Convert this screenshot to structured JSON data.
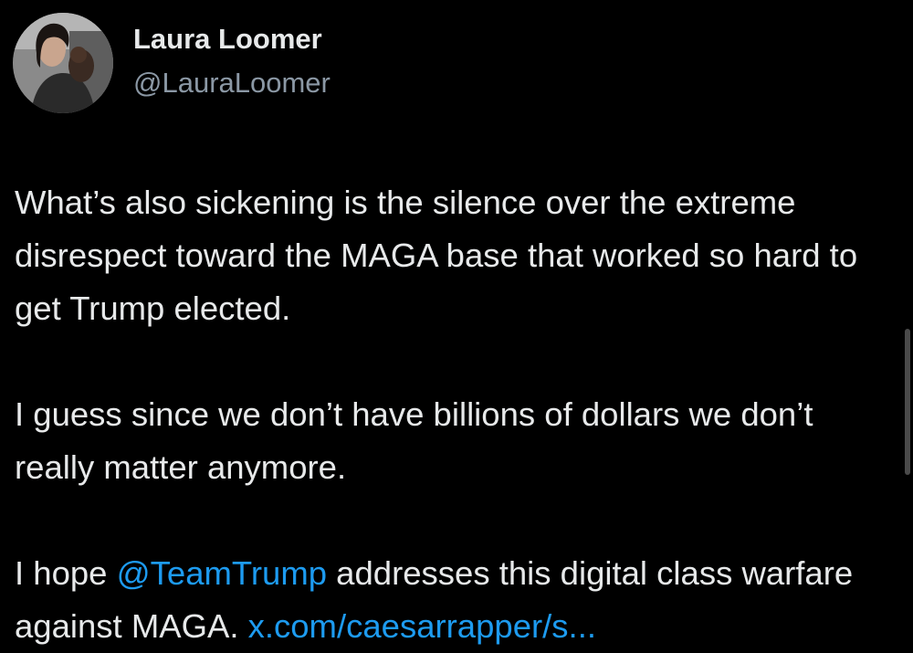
{
  "author": {
    "name": "Laura Loomer",
    "handle": "@LauraLoomer",
    "avatar_icon": "profile-photo"
  },
  "tweet": {
    "paragraph_1": "What’s also sickening is the silence over the extreme disrespect toward the MAGA base that worked so hard to get Trump elected.",
    "paragraph_2": "I guess since we don’t have billions of dollars we don’t really matter anymore.",
    "paragraph_3_before": "I hope ",
    "mention": "@TeamTrump",
    "paragraph_3_middle": " addresses this digital class warfare against MAGA. ",
    "link_text": "x.com/caesarrapper/s..."
  },
  "colors": {
    "background": "#000000",
    "text": "#e7e9ea",
    "secondary_text": "#8b98a5",
    "link": "#1d9bf0"
  }
}
